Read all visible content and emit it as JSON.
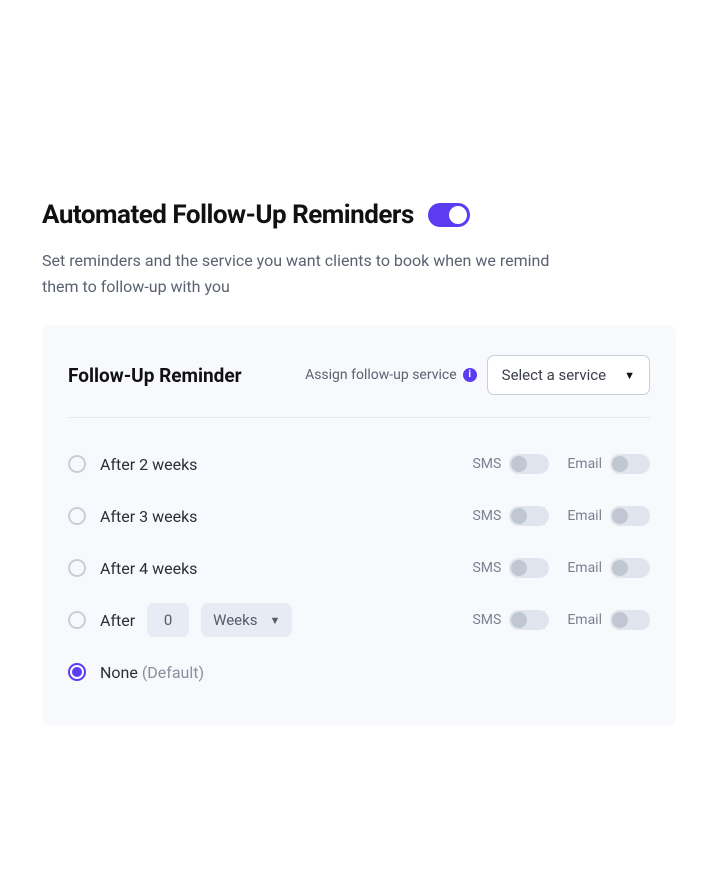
{
  "header": {
    "title": "Automated Follow-Up Reminders",
    "toggle_on": true
  },
  "subtitle": "Set reminders and the service you want clients to book when we remind them to follow-up with you",
  "panel": {
    "section_title": "Follow-Up Reminder",
    "assign_label": "Assign follow-up service",
    "service_select_placeholder": "Select a service"
  },
  "options": [
    {
      "label": "After 2 weeks",
      "selected": false,
      "has_channels": true
    },
    {
      "label": "After 3 weeks",
      "selected": false,
      "has_channels": true
    },
    {
      "label": "After 4 weeks",
      "selected": false,
      "has_channels": true
    }
  ],
  "custom_option": {
    "prefix": "After",
    "value": "0",
    "unit": "Weeks",
    "selected": false
  },
  "none_option": {
    "label": "None",
    "default_tag": "(Default)",
    "selected": true
  },
  "channel_labels": {
    "sms": "SMS",
    "email": "Email"
  }
}
